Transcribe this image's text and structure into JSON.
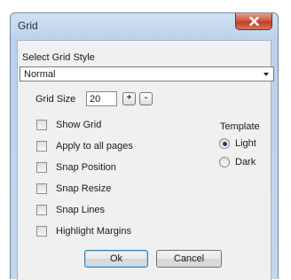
{
  "window": {
    "title": "Grid"
  },
  "style_section": {
    "label": "Select Grid Style",
    "selected": "Normal"
  },
  "grid_size": {
    "label": "Grid Size",
    "value": "20",
    "plus_label": "+",
    "minus_label": "-"
  },
  "options": [
    {
      "label": "Show Grid",
      "checked": false
    },
    {
      "label": "Apply to all pages",
      "checked": false
    },
    {
      "label": "Snap Position",
      "checked": false
    },
    {
      "label": "Snap Resize",
      "checked": false
    },
    {
      "label": "Snap Lines",
      "checked": false
    },
    {
      "label": "Highlight Margins",
      "checked": false
    }
  ],
  "template": {
    "label": "Template",
    "options": [
      {
        "label": "Light",
        "selected": true
      },
      {
        "label": "Dark",
        "selected": false
      }
    ]
  },
  "buttons": {
    "ok": "Ok",
    "cancel": "Cancel"
  },
  "colors": {
    "frame": "#bcd2ea",
    "close": "#c13d25",
    "client": "#f0f0f0"
  }
}
